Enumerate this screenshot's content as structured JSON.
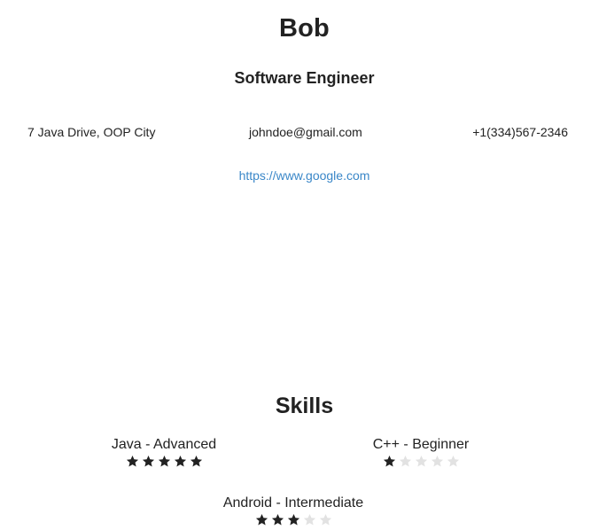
{
  "header": {
    "name": "Bob",
    "title": "Software Engineer"
  },
  "contact": {
    "address": "7 Java Drive, OOP City",
    "email": "johndoe@gmail.com",
    "phone": "+1(334)567-2346",
    "website": "https://www.google.com"
  },
  "skills": {
    "heading": "Skills",
    "items": [
      {
        "label": "Java - Advanced",
        "rating": 5,
        "max": 5
      },
      {
        "label": "C++ - Beginner",
        "rating": 1,
        "max": 5
      },
      {
        "label": "Android - Intermediate",
        "rating": 3,
        "max": 5
      }
    ]
  },
  "colors": {
    "text": "#222222",
    "link": "#3a87c8",
    "star_filled": "#222222",
    "star_empty": "#e2e2e2"
  }
}
